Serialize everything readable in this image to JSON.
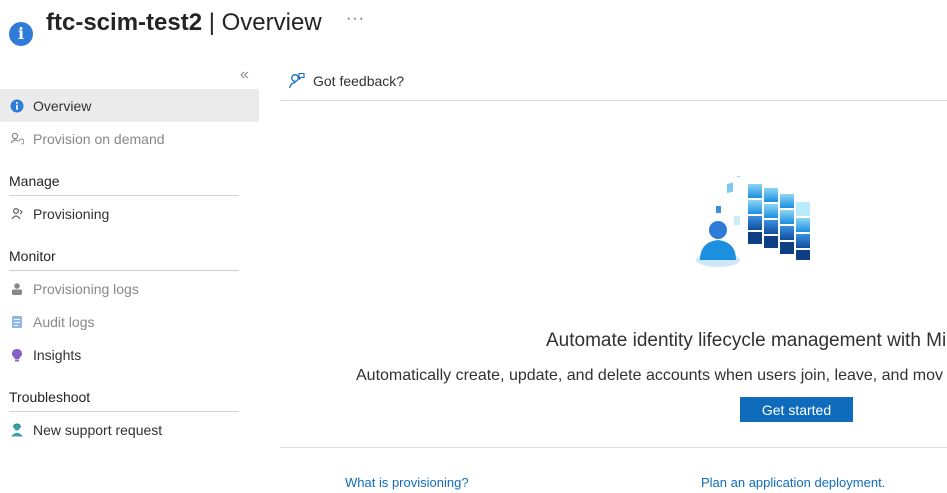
{
  "header": {
    "app_name": "ftc-scim-test2",
    "separator": " | ",
    "page_name": "Overview",
    "more_label": "···",
    "info_icon": "info-icon"
  },
  "sidebar": {
    "collapse_label": "«",
    "items": [
      {
        "label": "Overview",
        "icon": "info-icon",
        "state": "active"
      },
      {
        "label": "Provision on demand",
        "icon": "provision-user-icon",
        "state": "disabled"
      }
    ],
    "sections": [
      {
        "title": "Manage",
        "items": [
          {
            "label": "Provisioning",
            "icon": "provisioning-icon",
            "state": "normal"
          }
        ]
      },
      {
        "title": "Monitor",
        "items": [
          {
            "label": "Provisioning logs",
            "icon": "user-log-icon",
            "state": "disabled"
          },
          {
            "label": "Audit logs",
            "icon": "audit-log-icon",
            "state": "disabled"
          },
          {
            "label": "Insights",
            "icon": "insights-bulb-icon",
            "state": "normal"
          }
        ]
      },
      {
        "title": "Troubleshoot",
        "items": [
          {
            "label": "New support request",
            "icon": "support-person-icon",
            "state": "normal"
          }
        ]
      }
    ]
  },
  "toolbar": {
    "feedback_label": "Got feedback?"
  },
  "main": {
    "illustration": "identity-provisioning-illustration",
    "headline": "Automate identity lifecycle management with Mic",
    "description": "Automatically create, update, and delete accounts when users join, leave, and mov",
    "cta_label": "Get started",
    "links": {
      "what_is": "What is provisioning?",
      "plan": "Plan an application deployment."
    }
  },
  "colors": {
    "accent": "#0f6cbd",
    "active_bg": "#ebebeb",
    "disabled_text": "#8a8886"
  }
}
